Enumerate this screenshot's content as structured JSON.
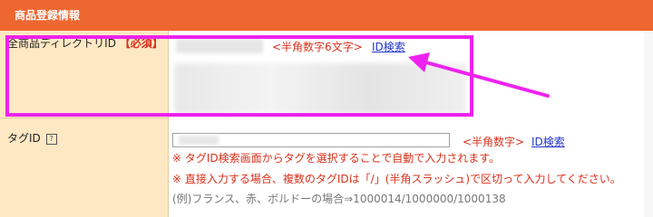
{
  "header": {
    "title": "商品登録情報"
  },
  "row1": {
    "label": "全商品ディレクトリID",
    "required": "【必須】",
    "hint": "<半角数字6文字>",
    "link": "ID検索"
  },
  "row2": {
    "label": "タグID",
    "help_icon": "?",
    "hint": "<半角数字>",
    "link": "ID検索",
    "note1": "※ タグID検索画面からタグを選択することで自動で入力されます。",
    "note2": "※ 直接入力する場合、複数のタグIDは「/」(半角スラッシュ)で区切って入力してください。",
    "example": "(例)フランス、赤、ボルドーの場合⇒1000014/1000000/1000138"
  },
  "annotation": {
    "highlight_color": "#ee22ee"
  },
  "colors": {
    "header_bg": "#ee6630",
    "label_bg": "#fde8c4",
    "accent_red": "#d9301a",
    "link_blue": "#2233cc"
  }
}
